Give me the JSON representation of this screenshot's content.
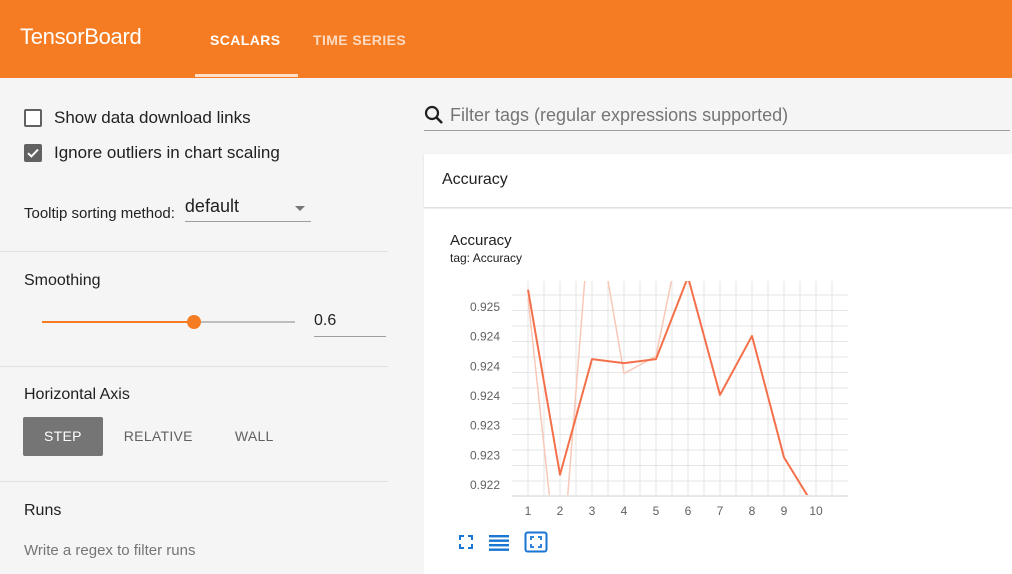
{
  "app": {
    "brand": "TensorBoard",
    "tabs": [
      {
        "label": "SCALARS",
        "active": true
      },
      {
        "label": "TIME SERIES",
        "active": false
      }
    ],
    "accent_color": "#f57c22"
  },
  "sidebar": {
    "show_download_links": {
      "label": "Show data download links",
      "checked": false
    },
    "ignore_outliers": {
      "label": "Ignore outliers in chart scaling",
      "checked": true
    },
    "tooltip_sorting": {
      "label": "Tooltip sorting method:",
      "value": "default"
    },
    "smoothing": {
      "label": "Smoothing",
      "value": "0.6",
      "fraction": 0.6
    },
    "horizontal_axis": {
      "label": "Horizontal Axis",
      "options": [
        "STEP",
        "RELATIVE",
        "WALL"
      ],
      "selected": "STEP"
    },
    "runs": {
      "label": "Runs",
      "filter_placeholder": "Write a regex to filter runs"
    }
  },
  "main": {
    "filter_placeholder": "Filter tags (regular expressions supported)",
    "card_header": "Accuracy"
  },
  "chart": {
    "title": "Accuracy",
    "tag": "tag: Accuracy"
  },
  "chart_data": {
    "type": "line",
    "title": "Accuracy",
    "subtitle": "tag: Accuracy",
    "x_ticks": [
      "1",
      "2",
      "3",
      "4",
      "5",
      "6",
      "7",
      "8",
      "9",
      "10"
    ],
    "y_ticks": [
      "0.925",
      "0.924",
      "0.924",
      "0.924",
      "0.923",
      "0.923",
      "0.922"
    ],
    "ylim": [
      0.9219,
      0.9256
    ],
    "xlim": [
      0.5,
      11
    ],
    "series": [
      {
        "kind": "smoothed",
        "color": "#f4704a",
        "x": [
          1,
          2,
          3,
          4,
          5,
          6,
          7,
          8,
          9,
          10
        ],
        "y": [
          0.92545,
          0.92225,
          0.92425,
          0.92418,
          0.92425,
          0.92567,
          0.92363,
          0.92465,
          0.92255,
          0.92165
        ]
      },
      {
        "kind": "raw",
        "color": "#f8c8b8",
        "x": [
          1,
          2,
          3,
          4,
          5,
          6
        ],
        "y": [
          0.9253,
          0.9202,
          0.9272,
          0.924,
          0.9243,
          0.927
        ]
      }
    ],
    "grid": true
  },
  "chart_icons": [
    "fit-screen-icon",
    "data-table-icon",
    "fit-domain-icon"
  ]
}
